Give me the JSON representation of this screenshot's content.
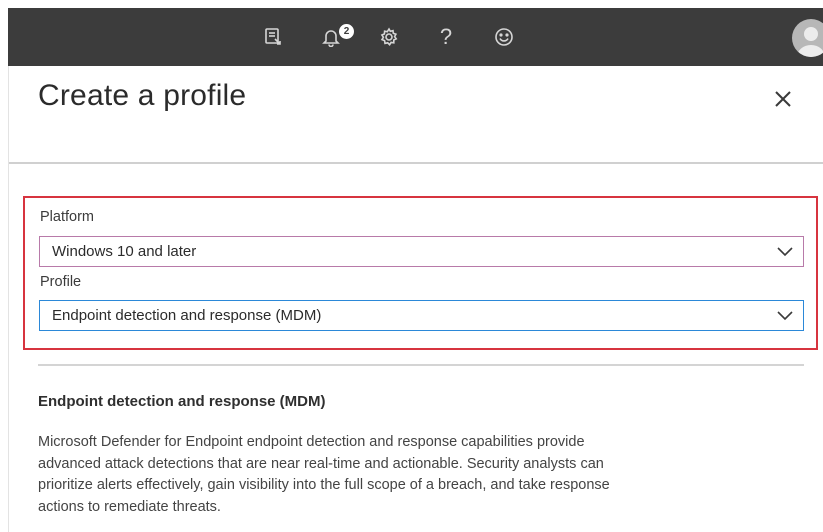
{
  "topbar": {
    "icons": [
      "feedback-icon",
      "notification-bell-icon",
      "settings-gear-icon",
      "help-icon",
      "smiley-icon",
      "user-avatar-icon"
    ],
    "notification_count": "2",
    "bg_color": "#3c3c3c"
  },
  "panel": {
    "title": "Create a profile",
    "close_icon": "close-icon"
  },
  "form": {
    "highlight_color": "#d7343f",
    "platform": {
      "label": "Platform",
      "value": "Windows 10 and later"
    },
    "profile": {
      "label": "Profile",
      "value": "Endpoint detection and response (MDM)"
    }
  },
  "details": {
    "heading": "Endpoint detection and response (MDM)",
    "description_lines": [
      "Microsoft Defender for Endpoint endpoint detection and response capabilities provide",
      "advanced attack detections that are near real-time and actionable. Security analysts can",
      "prioritize alerts effectively, gain visibility into the full scope of a breach, and take response",
      "actions to remediate threats."
    ]
  }
}
